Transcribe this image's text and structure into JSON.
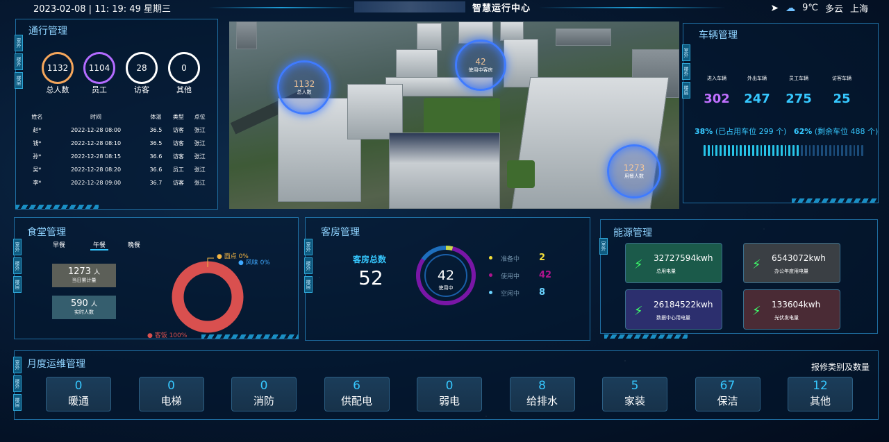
{
  "header": {
    "datetime": "2023-02-08 | 11: 19: 49 星期三",
    "title": "智慧运行中心",
    "weather": {
      "temp": "9℃",
      "condition": "多云",
      "city": "上海"
    }
  },
  "side_tabs": {
    "a": "室外",
    "b": "楼外",
    "c": "楼层"
  },
  "traffic": {
    "title": "通行管理",
    "stats": [
      {
        "value": "1132",
        "label": "总人数",
        "color": "#f5a65b"
      },
      {
        "value": "1104",
        "label": "员工",
        "color": "#b36bff"
      },
      {
        "value": "28",
        "label": "访客",
        "color": "#ffffff"
      },
      {
        "value": "0",
        "label": "其他",
        "color": "#ffffff"
      }
    ],
    "columns": [
      "姓名",
      "时间",
      "体温",
      "类型",
      "点位"
    ],
    "rows": [
      [
        "赵*",
        "2022-12-28 08:00",
        "36.5",
        "访客",
        "张江"
      ],
      [
        "钱*",
        "2022-12-28 08:10",
        "36.5",
        "访客",
        "张江"
      ],
      [
        "孙*",
        "2022-12-28 08:15",
        "36.6",
        "访客",
        "张江"
      ],
      [
        "吴*",
        "2022-12-28 08:20",
        "36.6",
        "员工",
        "张江"
      ],
      [
        "李*",
        "2022-12-28 09:00",
        "36.7",
        "访客",
        "张江"
      ]
    ]
  },
  "photo": {
    "rings": [
      {
        "value": "1132",
        "label": "总人数"
      },
      {
        "value": "42",
        "label": "使用中客房"
      },
      {
        "value": "1273",
        "label": "用餐人数"
      }
    ]
  },
  "vehicles": {
    "title": "车辆管理",
    "stats": [
      {
        "label": "进入车辆",
        "value": "302",
        "color": "#c070ff"
      },
      {
        "label": "外出车辆",
        "value": "247",
        "color": "#36c8ff"
      },
      {
        "label": "员工车辆",
        "value": "275",
        "color": "#36c8ff"
      },
      {
        "label": "访客车辆",
        "value": "25",
        "color": "#36c8ff"
      }
    ],
    "occupied_pct": "38%",
    "occupied_text": "(已占用车位 299 个)",
    "free_pct": "62%",
    "free_text": "(剩余车位 488 个)",
    "occupancy_fraction": 0.38
  },
  "canteen": {
    "title": "食堂管理",
    "tabs": [
      "早餐",
      "午餐",
      "晚餐"
    ],
    "total": {
      "value": "1273",
      "unit": "人",
      "label": "当日累计量"
    },
    "realtime": {
      "value": "590",
      "unit": "人",
      "label": "实时人数"
    },
    "pie": [
      {
        "label": "面点",
        "pct": "0%",
        "value": 0,
        "color": "#f5b642"
      },
      {
        "label": "风味",
        "pct": "0%",
        "value": 0,
        "color": "#3fa9ff"
      },
      {
        "label": "客饭",
        "pct": "100%",
        "value": 100,
        "color": "#d9504f"
      }
    ]
  },
  "rooms": {
    "title": "客房管理",
    "total_label": "客房总数",
    "total": "52",
    "center_value": "42",
    "center_label": "使用中",
    "legend": [
      {
        "label": "准备中",
        "value": "2",
        "color": "#f5e03a"
      },
      {
        "label": "使用中",
        "value": "42",
        "color": "#b0148e"
      },
      {
        "label": "空闲中",
        "value": "8",
        "color": "#6ad3ff"
      }
    ]
  },
  "energy": {
    "title": "能源管理",
    "items": [
      {
        "value": "32727594kwh",
        "label": "总用电量",
        "bg": "#1b5a4a"
      },
      {
        "value": "6543072kwh",
        "label": "办公年度用电量",
        "bg": "#3a3f44"
      },
      {
        "value": "26184522kwh",
        "label": "数据中心用电量",
        "bg": "#2c2f6e"
      },
      {
        "value": "133604kwh",
        "label": "光伏发电量",
        "bg": "#4a2b35"
      }
    ]
  },
  "monthly": {
    "title": "月度运维管理",
    "subtitle": "报修类别及数量",
    "items": [
      {
        "n": "0",
        "t": "暖通"
      },
      {
        "n": "0",
        "t": "电梯"
      },
      {
        "n": "0",
        "t": "消防"
      },
      {
        "n": "6",
        "t": "供配电"
      },
      {
        "n": "0",
        "t": "弱电"
      },
      {
        "n": "8",
        "t": "给排水"
      },
      {
        "n": "5",
        "t": "家装"
      },
      {
        "n": "67",
        "t": "保洁"
      },
      {
        "n": "12",
        "t": "其他"
      }
    ]
  }
}
